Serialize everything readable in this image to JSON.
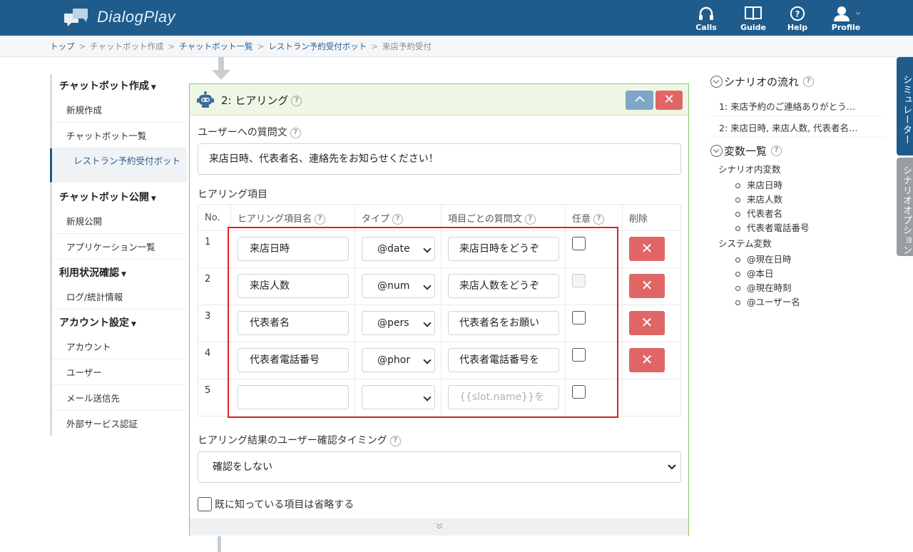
{
  "header": {
    "app_name": "DialogPlay",
    "nav": [
      {
        "label": "Calls",
        "icon": "headset-icon"
      },
      {
        "label": "Guide",
        "icon": "book-icon"
      },
      {
        "label": "Help",
        "icon": "question-icon"
      },
      {
        "label": "Profile",
        "icon": "user-icon"
      }
    ]
  },
  "breadcrumb": [
    "トップ",
    "チャットボット作成",
    "チャットボット一覧",
    "レストラン予約受付ボット",
    "来店予約受付"
  ],
  "sidebar": {
    "sections": [
      {
        "title": "チャットボット作成",
        "items": [
          "新規作成",
          "チャットボット一覧",
          "レストラン予約受付ボット"
        ]
      },
      {
        "title": "チャットボット公開",
        "items": [
          "新規公開",
          "アプリケーション一覧"
        ]
      },
      {
        "title": "利用状況確認",
        "items": [
          "ログ/統計情報"
        ]
      },
      {
        "title": "アカウント設定",
        "items": [
          "アカウント",
          "ユーザー",
          "メール送信先",
          "外部サービス認証"
        ]
      }
    ]
  },
  "card": {
    "title": "2: ヒアリング",
    "question_label": "ユーザーへの質問文",
    "question_value": "来店日時、代表者名、連絡先をお知らせください！",
    "items_label": "ヒアリング項目",
    "columns": [
      "No.",
      "ヒアリング項目名",
      "タイプ",
      "項目ごとの質問文",
      "任意",
      "削除"
    ],
    "rows": [
      {
        "no": "1",
        "name": "来店日時",
        "type": "@date",
        "question": "来店日時をどうぞ",
        "optional": false
      },
      {
        "no": "2",
        "name": "来店人数",
        "type": "@num",
        "question": "来店人数をどうぞ",
        "optional": false
      },
      {
        "no": "3",
        "name": "代表者名",
        "type": "@pers",
        "question": "代表者名をお願い",
        "optional": false
      },
      {
        "no": "4",
        "name": "代表者電話番号",
        "type": "@phor",
        "question": "代表者電話番号を",
        "optional": false
      },
      {
        "no": "5",
        "name": "",
        "type": "",
        "question_placeholder": "{{slot.name}}を",
        "optional": false
      }
    ],
    "confirm_label": "ヒアリング結果のユーザー確認タイミング",
    "confirm_value": "確認をしない",
    "skip_known_label": "既に知っている項目は省略する"
  },
  "right_panel": {
    "flow_title": "シナリオの流れ",
    "flow_items": [
      "1: 来店予約のご連絡ありがとう…",
      "2: 来店日時, 来店人数, 代表者名…"
    ],
    "vars_title": "変数一覧",
    "scenario_vars_title": "シナリオ内変数",
    "scenario_vars": [
      "来店日時",
      "来店人数",
      "代表者名",
      "代表者電話番号"
    ],
    "system_vars_title": "システム変数",
    "system_vars": [
      "@現在日時",
      "@本日",
      "@現在時刻",
      "@ユーザー名"
    ]
  },
  "tabs": {
    "simulator": "シミュレーター",
    "scenario_options": "シナリオオプション"
  },
  "colors": {
    "header": "#1f5c8c",
    "danger": "#e06666",
    "highlight": "#dd2222",
    "card_border": "#8dc26a"
  }
}
